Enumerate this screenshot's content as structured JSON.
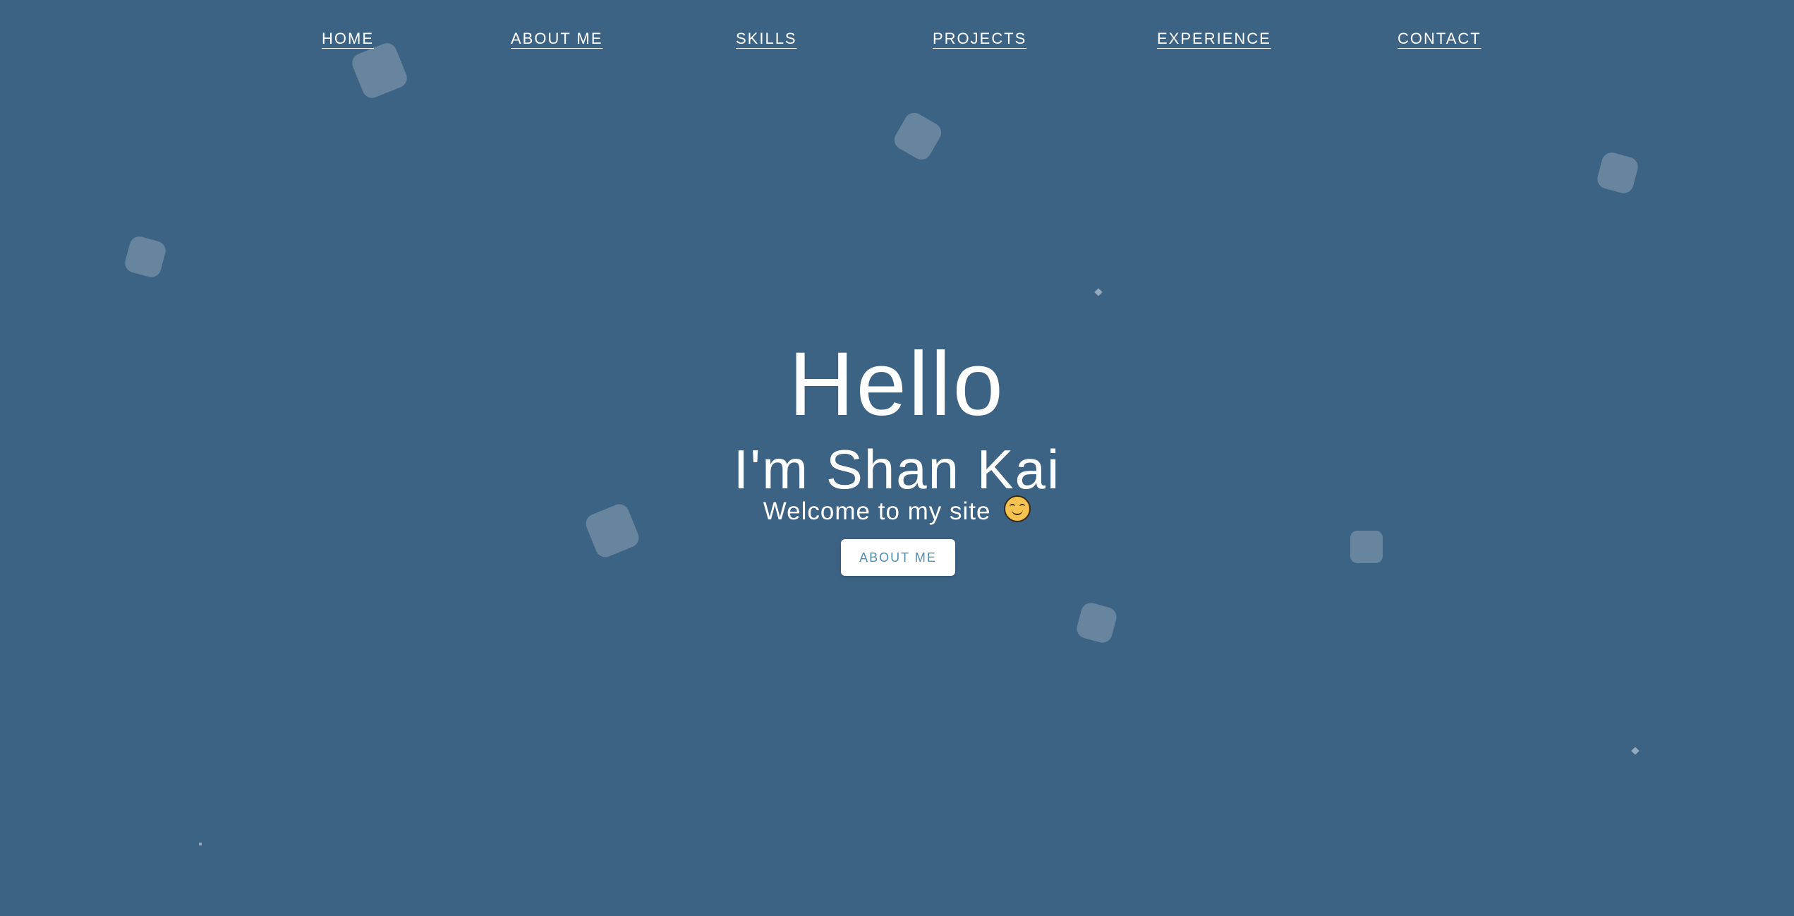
{
  "nav": {
    "home": "HOME",
    "about": "ABOUT ME",
    "skills": "SKILLS",
    "projects": "PROJECTS",
    "experience": "EXPERIENCE",
    "contact": "CONTACT"
  },
  "hero": {
    "greeting": "Hello",
    "name": "I'm Shan Kai",
    "tagline": "Welcome to my site",
    "emoji_icon": "smiling-face-icon",
    "button_label": "ABOUT ME"
  },
  "colors": {
    "background": "#3d6384",
    "text": "#ffffff",
    "button_text": "#4f8fb0"
  }
}
